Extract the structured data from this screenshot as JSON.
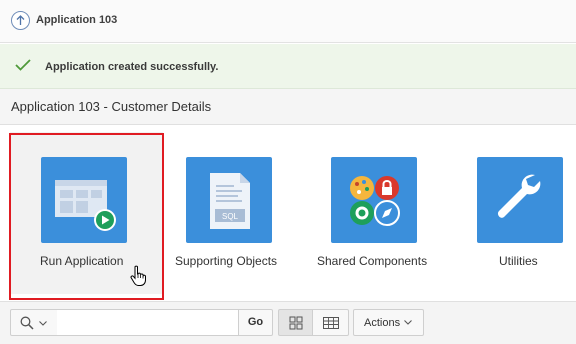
{
  "breadcrumb": {
    "label": "Application 103",
    "up_icon": "up-arrow-circle-icon"
  },
  "message": {
    "text": "Application created successfully.",
    "icon": "check-icon",
    "color": "#4f9a3a"
  },
  "region": {
    "title": "Application 103 - Customer Details"
  },
  "tiles": [
    {
      "label": "Run Application",
      "icon": "run-application-icon",
      "selected": true
    },
    {
      "label": "Supporting Objects",
      "icon": "sql-file-icon"
    },
    {
      "label": "Shared Components",
      "icon": "shared-components-icon"
    },
    {
      "label": "Utilities",
      "icon": "wrench-icon"
    }
  ],
  "toolbar": {
    "search_icon": "search-icon",
    "search_value": "",
    "go_label": "Go",
    "view_icon_label": "icon-view-icon",
    "view_report_label": "report-view-icon",
    "actions_label": "Actions"
  },
  "colors": {
    "tile": "#3b8fdb",
    "highlight": "#e01b22",
    "play": "#1e9f5b"
  }
}
